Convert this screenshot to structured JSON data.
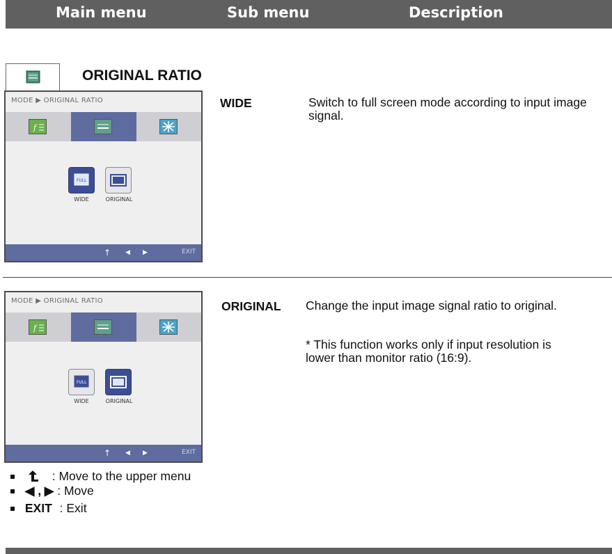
{
  "header": {
    "main_menu": "Main menu",
    "sub_menu": "Sub menu",
    "description": "Description"
  },
  "section": {
    "icon": "original-ratio-icon",
    "title": "ORIGINAL RATIO"
  },
  "osd": {
    "breadcrumb": "MODE ▶ ORIGINAL RATIO",
    "tabs": [
      "picture-mode-icon",
      "original-ratio-icon",
      "settings-icon"
    ],
    "options": [
      "WIDE",
      "ORIGINAL"
    ],
    "footer": {
      "up_glyph": "↑",
      "left_glyph": "◀",
      "right_glyph": "▶",
      "exit": "EXIT"
    }
  },
  "entries": [
    {
      "term": "WIDE",
      "description": "Switch to full screen mode according to input image signal.",
      "selected_option": "WIDE"
    },
    {
      "term": "ORIGINAL",
      "description": "Change the input image signal ratio to original.",
      "note": "* This function works only if input resolution is lower than monitor ratio (16:9).",
      "selected_option": "ORIGINAL"
    }
  ],
  "legend": [
    {
      "key": "",
      "text": ": Move to the upper menu",
      "icon": "up-arrow-icon"
    },
    {
      "key": "◀ , ▶",
      "text": ": Move"
    },
    {
      "key": "EXIT",
      "text": ": Exit"
    }
  ],
  "colors": {
    "header_bar": "#606060",
    "osd_accent": "#5f6ca0",
    "option_selected": "#3c4e96"
  }
}
